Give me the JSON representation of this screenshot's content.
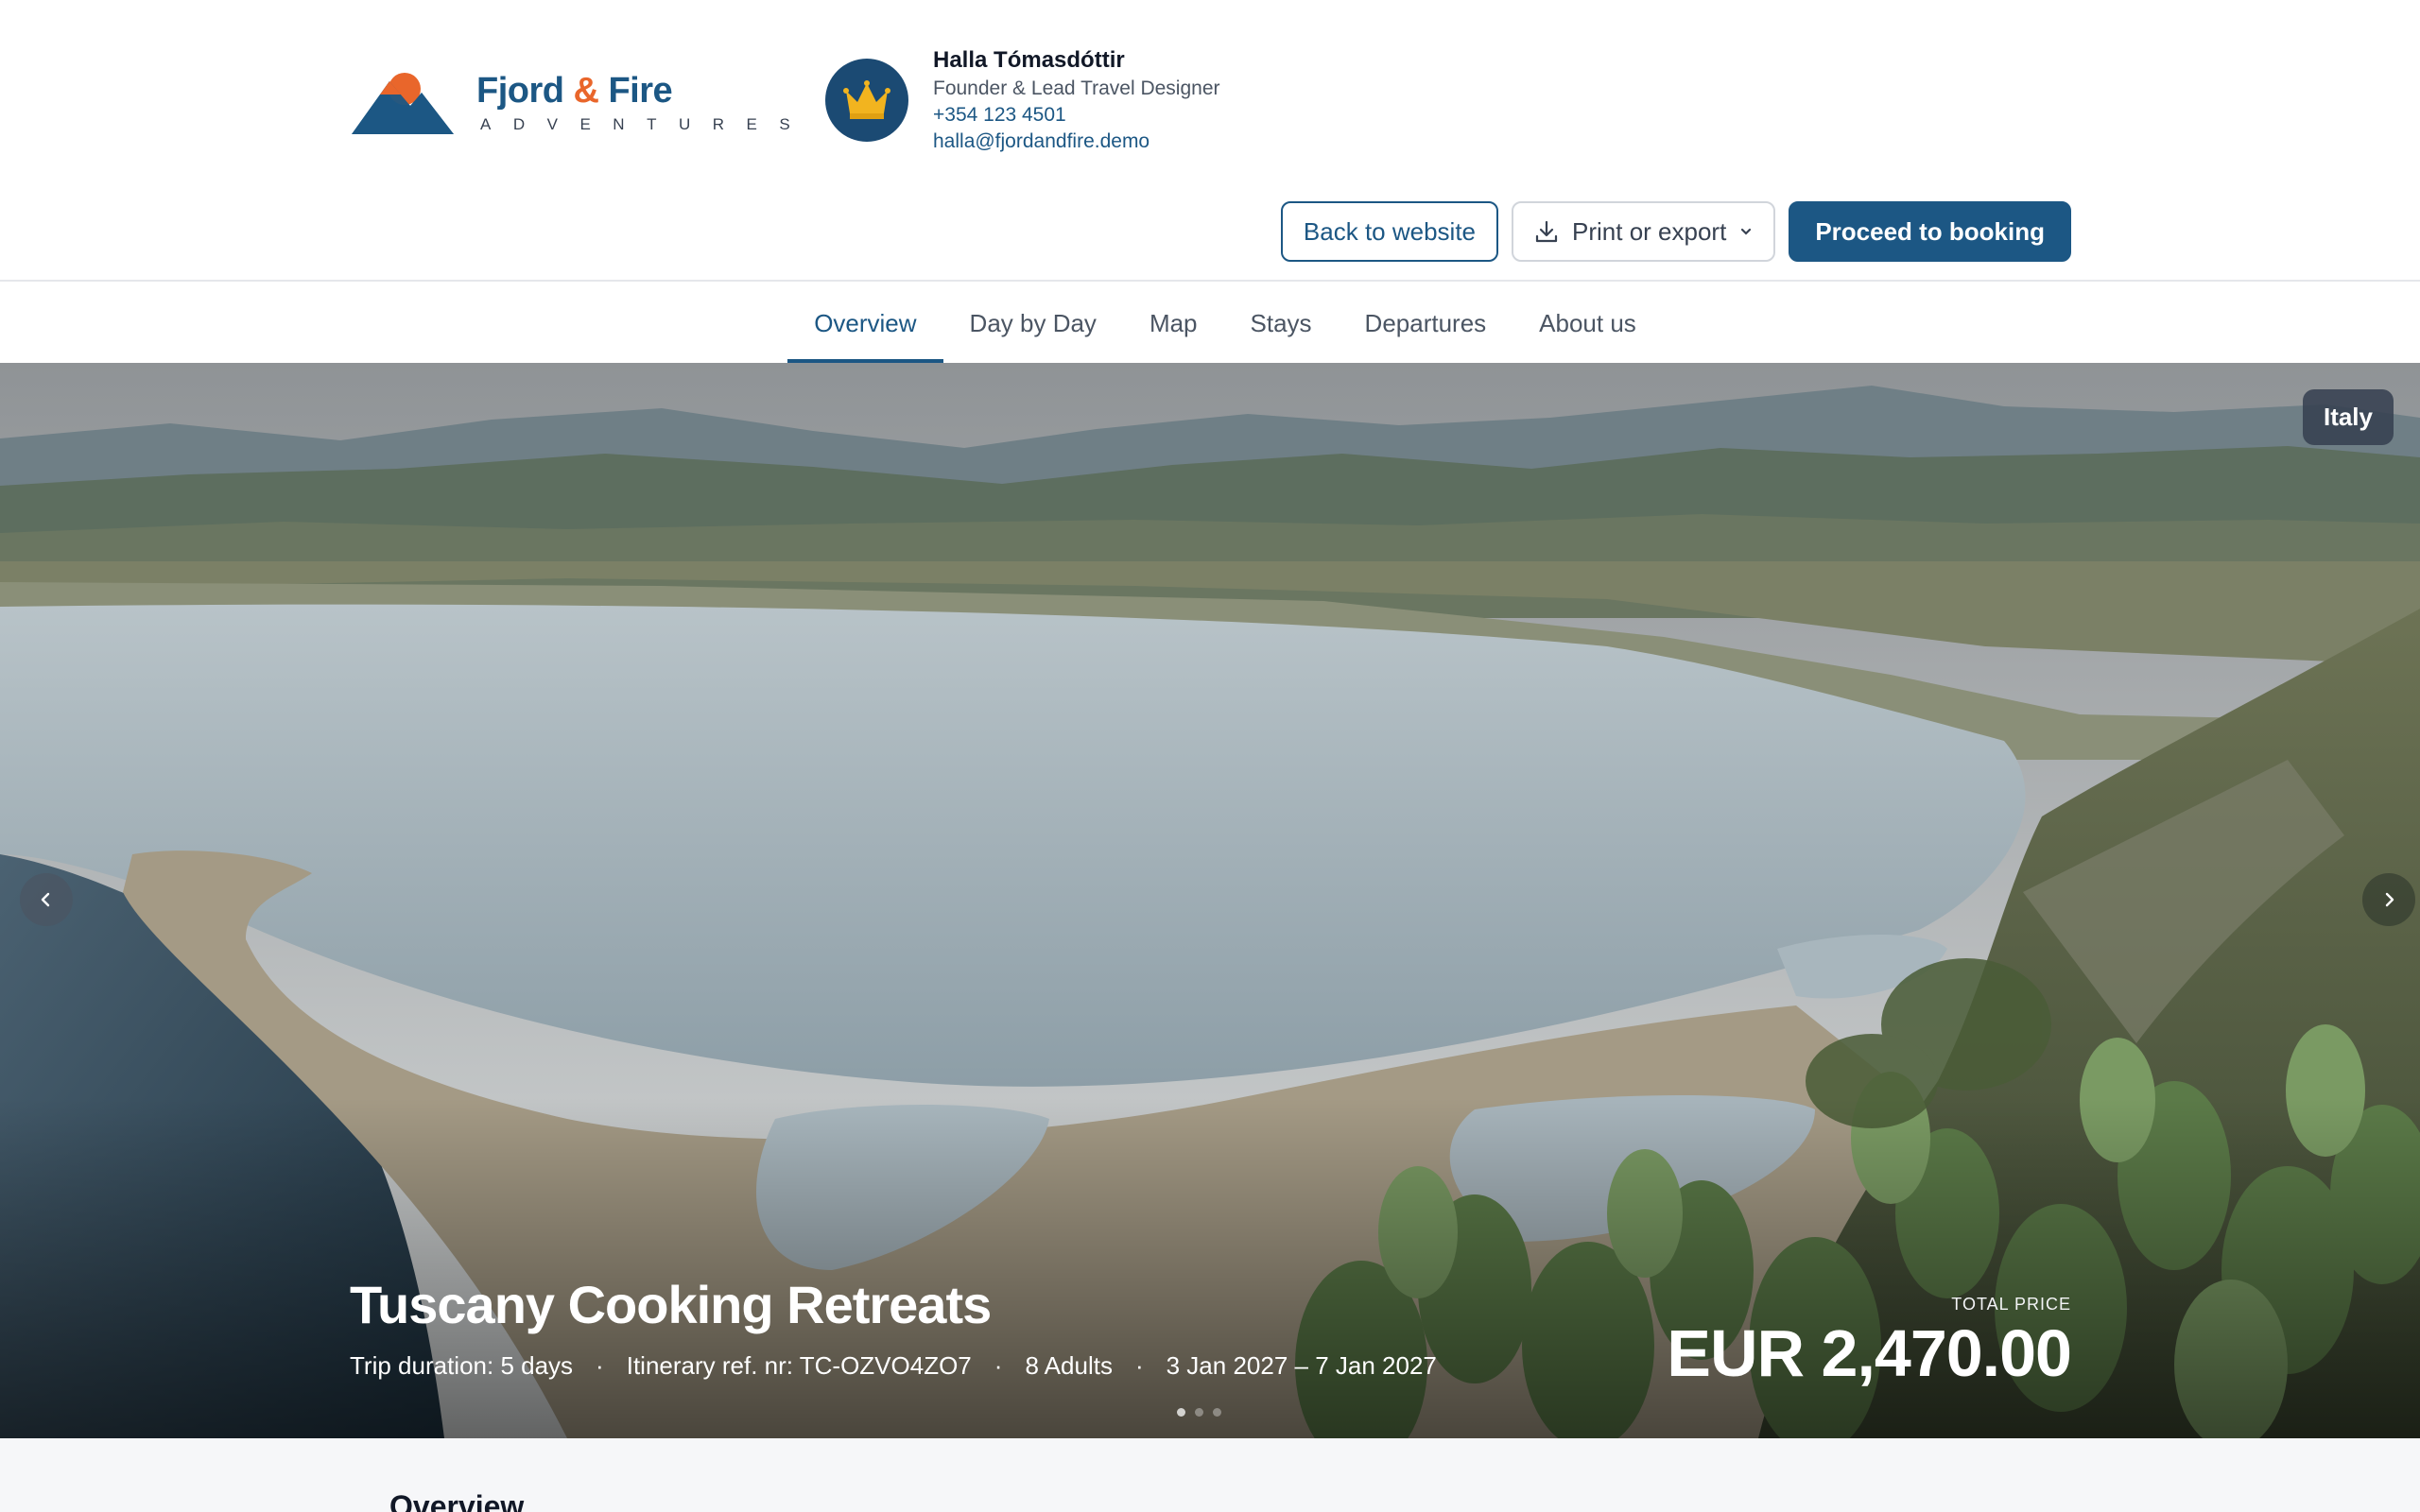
{
  "brand": {
    "name_part1": "Fjord",
    "name_amp": "&",
    "name_part2": "Fire",
    "tagline": "ADVENTURES",
    "colors": {
      "primary": "#1c5784",
      "accent": "#e9662b"
    }
  },
  "agent": {
    "name": "Halla Tómasdóttir",
    "role": "Founder & Lead Travel Designer",
    "phone": "+354 123 4501",
    "email": "halla@fjordandfire.demo",
    "avatar_icon": "crown-icon"
  },
  "actions": {
    "back_label": "Back to website",
    "print_label": "Print or export",
    "booking_label": "Proceed to booking"
  },
  "tabs": [
    {
      "label": "Overview",
      "active": true
    },
    {
      "label": "Day by Day",
      "active": false
    },
    {
      "label": "Map",
      "active": false
    },
    {
      "label": "Stays",
      "active": false
    },
    {
      "label": "Departures",
      "active": false
    },
    {
      "label": "About us",
      "active": false
    }
  ],
  "hero": {
    "country": "Italy",
    "title": "Tuscany Cooking Retreats",
    "duration": "Trip duration: 5 days",
    "reference": "Itinerary ref. nr: TC-OZVO4ZO7",
    "travellers": "8 Adults",
    "dates": "3 Jan 2027 – 7 Jan 2027",
    "separator": "·",
    "price_label": "TOTAL PRICE",
    "price": "EUR 2,470.00"
  },
  "section": {
    "title": "Overview"
  }
}
